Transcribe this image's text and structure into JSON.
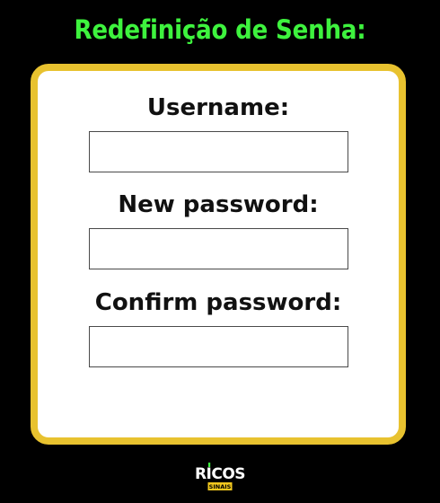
{
  "page": {
    "title": "Redefinição de Senha:"
  },
  "form": {
    "username_label": "Username:",
    "username_value": "",
    "new_password_label": "New password:",
    "new_password_value": "",
    "confirm_password_label": "Confirm password:",
    "confirm_password_value": ""
  },
  "logo": {
    "name": "RICOS",
    "tagline": "SINAIS"
  },
  "colors": {
    "background": "#000000",
    "title": "#3ef33e",
    "card_border": "#e8c22f",
    "card": "#ffffff",
    "logo_accent": "#f2c81e",
    "logo_green": "#3ef33e"
  }
}
